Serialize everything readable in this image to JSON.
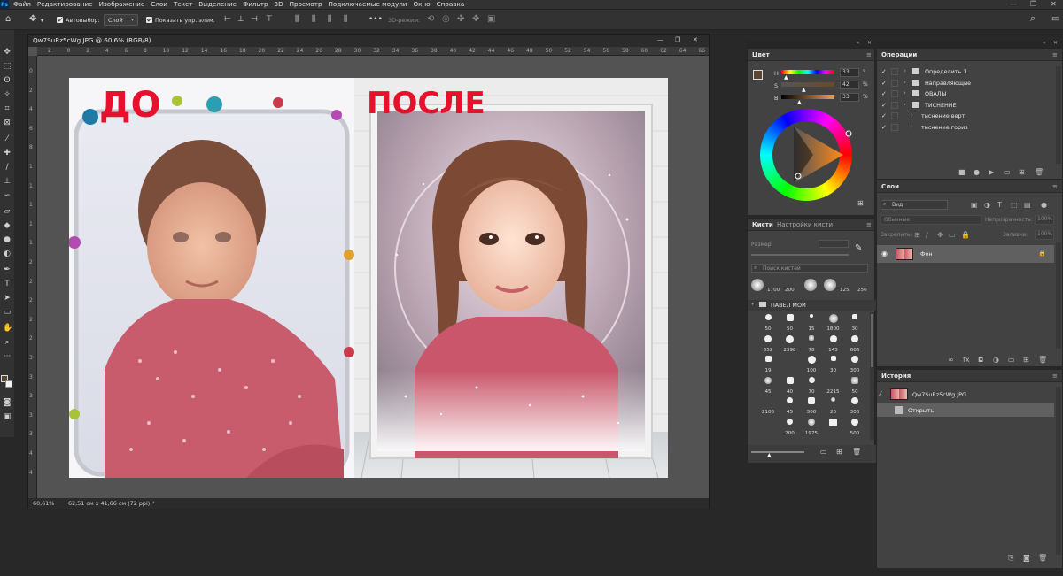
{
  "menu": {
    "logo": "Ps",
    "items": [
      "Файл",
      "Редактирование",
      "Изображение",
      "Слои",
      "Текст",
      "Выделение",
      "Фильтр",
      "3D",
      "Просмотр",
      "Подключаемые модули",
      "Окно",
      "Справка"
    ],
    "window_controls": [
      "—",
      "❐",
      "✕"
    ]
  },
  "options": {
    "autoselect_label": "Автовыбор:",
    "autoselect_value": "Слой",
    "show_transform_label": "Показать упр. элем.",
    "mode_3d_label": "3D-режим:"
  },
  "document": {
    "tab_title": "Qw7SuRz5cWg.JPG @ 60,6% (RGB/8)",
    "zoom": "60,61%",
    "size_info": "62,51 см x 41,66 см (72 ppi)",
    "ruler_ticks": [
      "2",
      "0",
      "2",
      "4",
      "6",
      "8",
      "10",
      "12",
      "14",
      "16",
      "18",
      "20",
      "22",
      "24",
      "26",
      "28",
      "30",
      "32",
      "34",
      "36",
      "38",
      "40",
      "42",
      "44",
      "46",
      "48",
      "50",
      "52",
      "54",
      "56",
      "58",
      "60",
      "62",
      "64",
      "66"
    ],
    "ruler_v_ticks": [
      "0",
      "2",
      "4",
      "6",
      "8",
      "1",
      "1",
      "1",
      "1",
      "1",
      "2",
      "2",
      "2",
      "2",
      "2",
      "3",
      "3",
      "3",
      "3",
      "3",
      "4",
      "4"
    ],
    "before_label": "ДО",
    "after_label": "ПОСЛЕ"
  },
  "color_panel": {
    "tab": "Цвет",
    "h_label": "H",
    "s_label": "S",
    "b_label": "B",
    "h_value": "33",
    "s_value": "42",
    "b_value": "33",
    "h_unit": "°",
    "s_unit": "%",
    "b_unit": "%"
  },
  "brushes_panel": {
    "tab_active": "Кисти",
    "tab_inactive": "Настройки кисти",
    "size_label": "Размер:",
    "search_placeholder": "Поиск кистей",
    "top_sizes": [
      "1700",
      "200",
      "125",
      "250"
    ],
    "group_name": "ПАВЕЛ МОИ",
    "grid_sizes": [
      "50",
      "50",
      "15",
      "1800",
      "30",
      "652",
      "2398",
      "78",
      "145",
      "666",
      "19",
      "",
      "100",
      "30",
      "300",
      "45",
      "40",
      "70",
      "2215",
      "50",
      "2100",
      "45",
      "300",
      "20",
      "300",
      "",
      "200",
      "1975",
      "",
      "500"
    ]
  },
  "actions_panel": {
    "tab": "Операции",
    "rows": [
      {
        "label": "Определить 1",
        "has_folder": true,
        "indent": 0
      },
      {
        "label": "Направляющие",
        "has_folder": true,
        "indent": 0
      },
      {
        "label": "ОВАЛЫ",
        "has_folder": true,
        "indent": 0
      },
      {
        "label": "ТИСНЕНИЕ",
        "has_folder": true,
        "indent": 0
      },
      {
        "label": "тиснение верт",
        "has_folder": false,
        "indent": 1
      },
      {
        "label": "тиснение гориз",
        "has_folder": false,
        "indent": 1
      }
    ]
  },
  "layers_panel": {
    "tab": "Слои",
    "search_placeholder": "Вид",
    "blend_mode": "Обычные",
    "opacity_label": "Непрозрачность:",
    "opacity_value": "100%",
    "lock_label": "Закрепить:",
    "fill_label": "Заливка:",
    "fill_value": "100%",
    "layer_name": "Фон"
  },
  "history_panel": {
    "tab": "История",
    "snapshot": "Qw7SuRz5cWg.JPG",
    "step": "Открыть"
  },
  "colors": {
    "accent_blue": "#31a8ff",
    "before_after_red": "#e8112d",
    "panel_bg": "#424242"
  }
}
